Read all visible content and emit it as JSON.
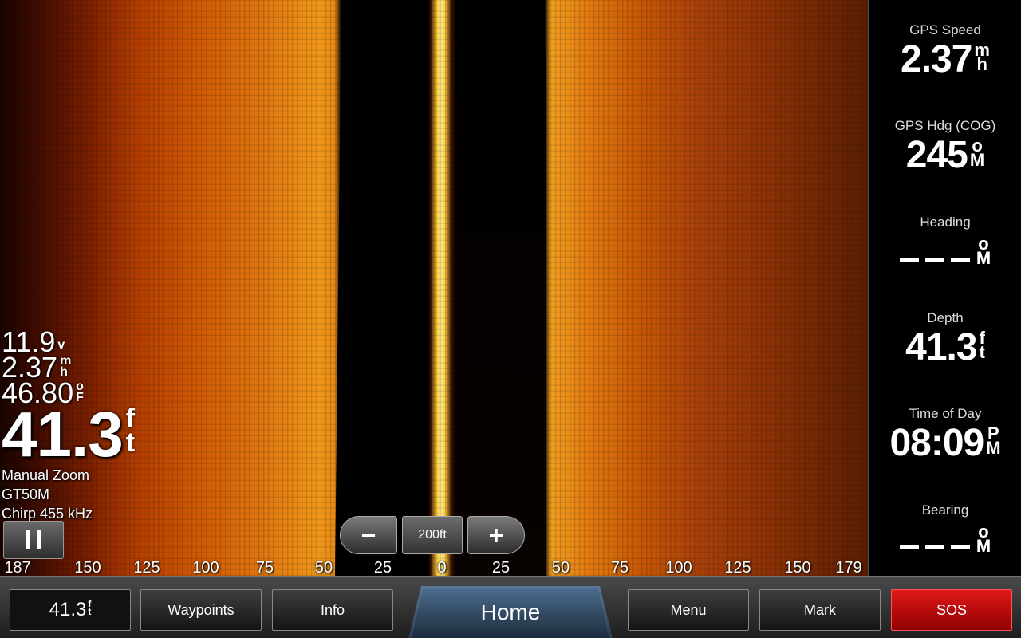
{
  "left_readouts": {
    "voltage": {
      "value": "11.9",
      "unit": [
        "v"
      ]
    },
    "speed": {
      "value": "2.37",
      "unit": [
        "m",
        "h"
      ]
    },
    "temperature": {
      "value": "46.80",
      "unit": [
        "o",
        "F"
      ]
    },
    "depth": {
      "value": "41.3",
      "unit": [
        "f",
        "t"
      ]
    },
    "zoom_mode": "Manual Zoom",
    "transducer": "GT50M",
    "frequency": "Chirp 455 kHz"
  },
  "zoom": {
    "minus": "−",
    "value": "200ft",
    "plus": "+"
  },
  "scale_labels": [
    "187",
    "150",
    "125",
    "100",
    "75",
    "50",
    "25",
    "0",
    "25",
    "50",
    "75",
    "100",
    "125",
    "150",
    "179"
  ],
  "right_panel": {
    "gps_speed": {
      "label": "GPS Speed",
      "value": "2.37",
      "unit": [
        "m",
        "h"
      ]
    },
    "gps_hdg": {
      "label": "GPS Hdg (COG)",
      "value": "245",
      "unit": [
        "o",
        "M"
      ]
    },
    "heading": {
      "label": "Heading",
      "unit": [
        "o",
        "M"
      ]
    },
    "depth": {
      "label": "Depth",
      "value": "41.3",
      "unit": [
        "f",
        "t"
      ]
    },
    "time": {
      "label": "Time of Day",
      "value": "08:09",
      "unit": [
        "P",
        "M"
      ]
    },
    "bearing": {
      "label": "Bearing",
      "unit": [
        "o",
        "M"
      ]
    }
  },
  "bottom_bar": {
    "depth_value": "41.3",
    "depth_unit": [
      "f",
      "t"
    ],
    "waypoints": "Waypoints",
    "info": "Info",
    "home": "Home",
    "menu": "Menu",
    "mark": "Mark",
    "sos": "SOS"
  },
  "colors": {
    "sos": "#d01010",
    "home_tab": "#4a6a8c",
    "sonar_accent": "#e07810"
  }
}
